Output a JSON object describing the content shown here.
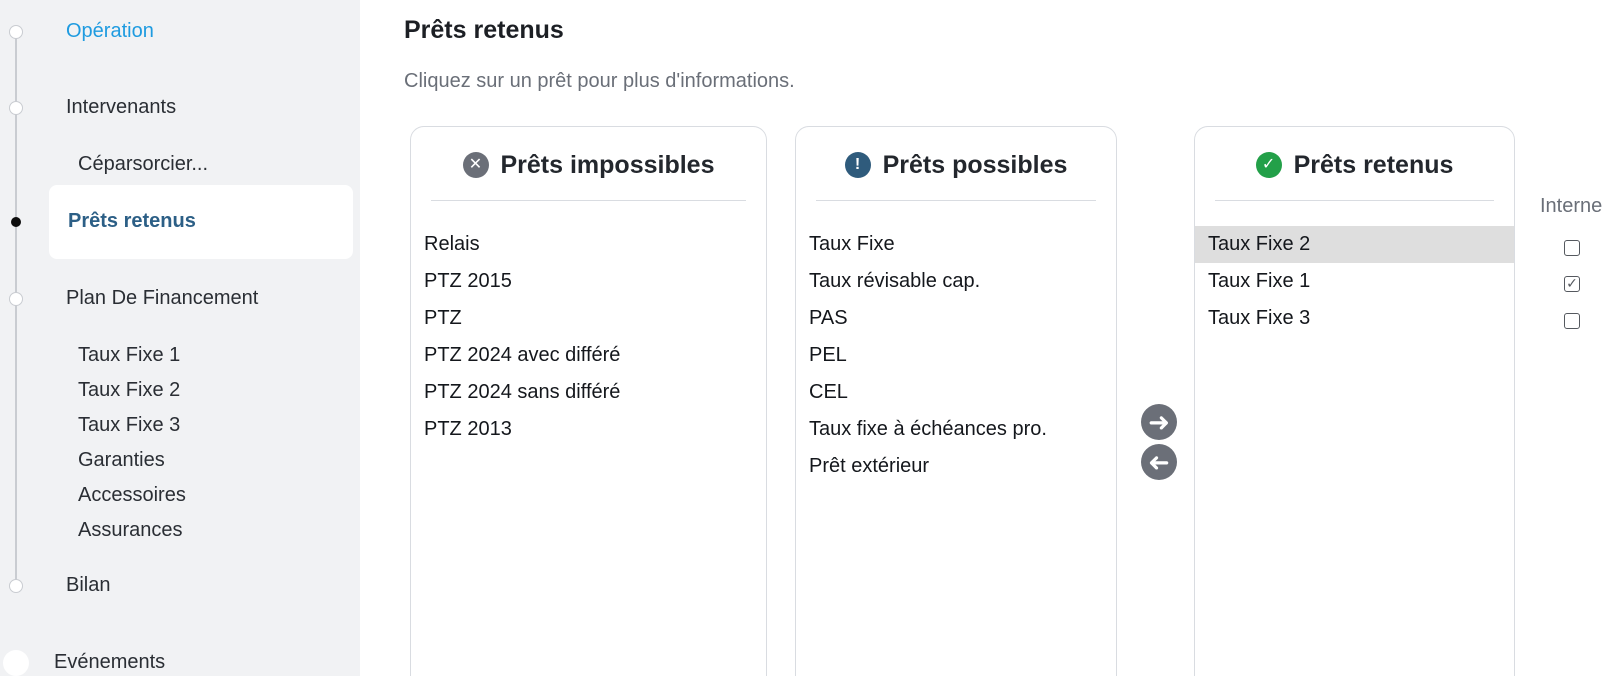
{
  "sidebar": {
    "items": [
      {
        "label": "Opération"
      },
      {
        "label": "Intervenants"
      },
      {
        "label": "Céparsorcier..."
      },
      {
        "label": "Prêts retenus"
      },
      {
        "label": "Plan De Financement"
      },
      {
        "label": "Taux Fixe 1"
      },
      {
        "label": "Taux Fixe 2"
      },
      {
        "label": "Taux Fixe 3"
      },
      {
        "label": "Garanties"
      },
      {
        "label": "Accessoires"
      },
      {
        "label": "Assurances"
      },
      {
        "label": "Bilan"
      },
      {
        "label": "Evénements"
      }
    ],
    "accent_color": "#1e9be0",
    "selected_color": "#2c5f86"
  },
  "main": {
    "title": "Prêts retenus",
    "subtitle": "Cliquez sur un prêt pour plus d'informations.",
    "panels": [
      {
        "title": "Prêts impossibles",
        "icon": "x-circle-icon",
        "items": [
          "Relais",
          "PTZ 2015",
          "PTZ",
          "PTZ 2024 avec différé",
          "PTZ 2024 sans différé",
          "PTZ 2013"
        ]
      },
      {
        "title": "Prêts possibles",
        "icon": "exclamation-circle-icon",
        "items": [
          "Taux Fixe",
          "Taux révisable cap.",
          "PAS",
          "PEL",
          "CEL",
          "Taux fixe à échéances pro.",
          "Prêt extérieur"
        ]
      },
      {
        "title": "Prêts retenus",
        "icon": "check-circle-icon",
        "items": [
          "Taux Fixe 2",
          "Taux Fixe 1",
          "Taux Fixe 3"
        ],
        "selected_index": 0
      }
    ],
    "interne": {
      "label": "Interne",
      "checked": [
        false,
        true,
        false
      ]
    }
  }
}
